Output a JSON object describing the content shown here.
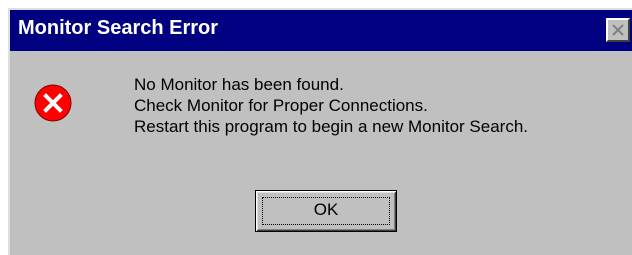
{
  "window": {
    "title": "Monitor Search Error",
    "close_icon": "close-icon"
  },
  "message": {
    "icon": "error-icon",
    "lines": [
      "No Monitor has been found.",
      "Check Monitor for Proper Connections.",
      "Restart this program to begin a new Monitor Search."
    ]
  },
  "buttons": {
    "ok_label": "OK"
  },
  "colors": {
    "titlebar": "#000080",
    "dialog_face": "#c0c0c0",
    "error_red": "#ff0000"
  }
}
